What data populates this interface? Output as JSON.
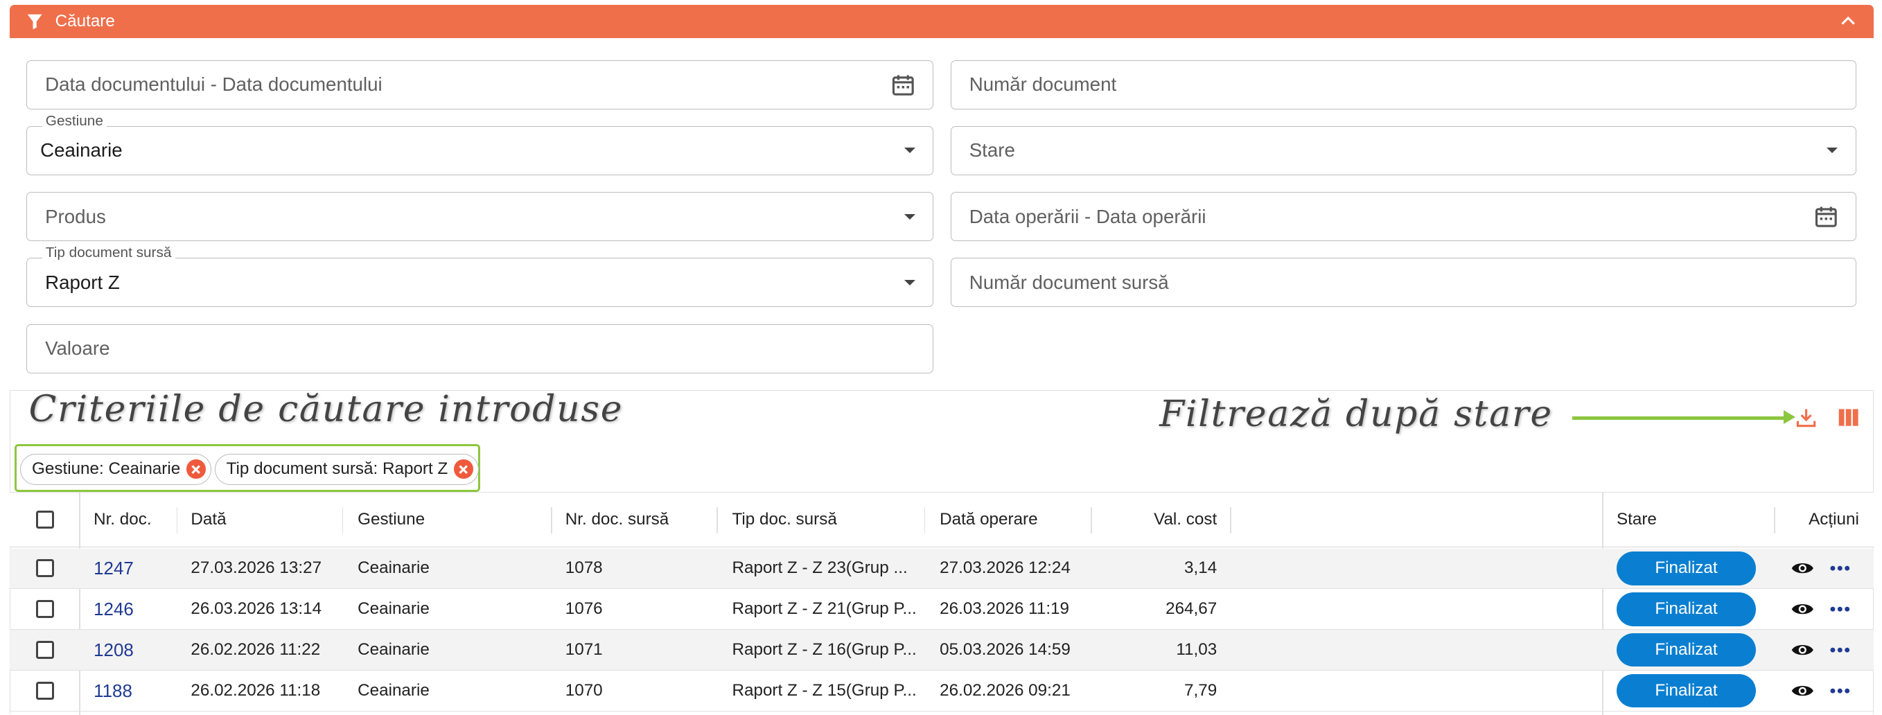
{
  "header": {
    "title": "Căutare"
  },
  "form": {
    "doc_date": {
      "placeholder": "Data documentului - Data documentului"
    },
    "doc_number": {
      "placeholder": "Număr document"
    },
    "gestiune": {
      "label": "Gestiune",
      "value": "Ceainarie"
    },
    "stare": {
      "placeholder": "Stare"
    },
    "produs": {
      "placeholder": "Produs"
    },
    "op_date": {
      "placeholder": "Data operării - Data operării"
    },
    "tip_doc_sursa": {
      "label": "Tip document sursă",
      "value": "Raport Z"
    },
    "nr_doc_sursa": {
      "placeholder": "Număr document sursă"
    },
    "valoare": {
      "placeholder": "Valoare"
    }
  },
  "annotations": {
    "criteria": "Criteriile de căutare introduse",
    "filter": "Filtrează după stare"
  },
  "chips": [
    {
      "label": "Gestiune: Ceainarie"
    },
    {
      "label": "Tip document sursă: Raport Z"
    }
  ],
  "table": {
    "columns": [
      "Nr. doc.",
      "Dată",
      "Gestiune",
      "Nr. doc. sursă",
      "Tip doc. sursă",
      "Dată operare",
      "Val. cost",
      "Stare",
      "Acțiuni"
    ],
    "rows": [
      {
        "nr": "1247",
        "data": "27.03.2026 13:27",
        "gestiune": "Ceainarie",
        "nr_sursa": "1078",
        "tip_sursa": "Raport Z - Z 23(Grup ...",
        "data_op": "27.03.2026 12:24",
        "val": "3,14",
        "stare": "Finalizat"
      },
      {
        "nr": "1246",
        "data": "26.03.2026 13:14",
        "gestiune": "Ceainarie",
        "nr_sursa": "1076",
        "tip_sursa": "Raport Z - Z 21(Grup P...",
        "data_op": "26.03.2026 11:19",
        "val": "264,67",
        "stare": "Finalizat"
      },
      {
        "nr": "1208",
        "data": "26.02.2026 11:22",
        "gestiune": "Ceainarie",
        "nr_sursa": "1071",
        "tip_sursa": "Raport Z - Z 16(Grup P...",
        "data_op": "05.03.2026 14:59",
        "val": "11,03",
        "stare": "Finalizat"
      },
      {
        "nr": "1188",
        "data": "26.02.2026 11:18",
        "gestiune": "Ceainarie",
        "nr_sursa": "1070",
        "tip_sursa": "Raport Z - Z 15(Grup P...",
        "data_op": "26.02.2026 09:21",
        "val": "7,79",
        "stare": "Finalizat"
      }
    ]
  },
  "colors": {
    "header": "#ef6f4b",
    "badge": "#0a7fd1",
    "annotation_highlight": "#8dc63f",
    "link": "#1f3a93"
  },
  "icons": [
    "filter-icon",
    "chevron-up-icon",
    "calendar-icon",
    "caret-down-icon",
    "download-icon",
    "columns-icon",
    "close-circle-icon",
    "eye-icon",
    "more-icon"
  ]
}
